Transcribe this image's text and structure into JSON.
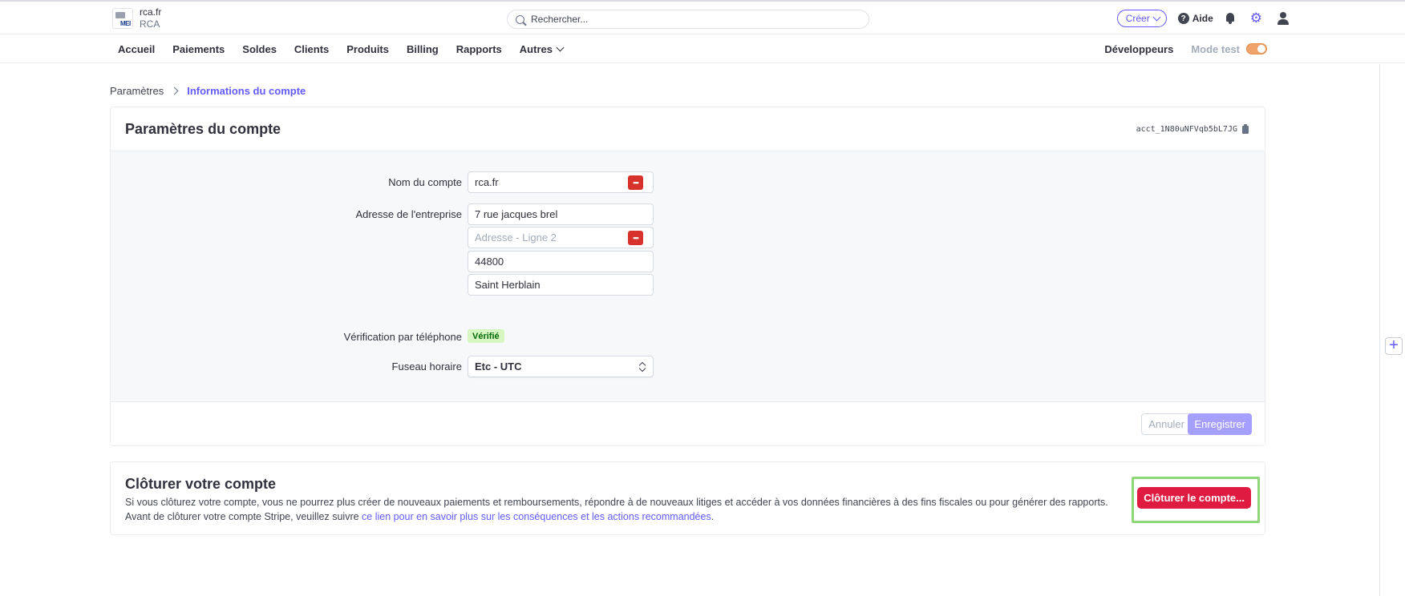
{
  "account": {
    "name": "rca.fr",
    "subname": "RCA",
    "logo_text": "MEI"
  },
  "search": {
    "placeholder": "Rechercher..."
  },
  "topbar": {
    "create_label": "Créer",
    "help_label": "Aide"
  },
  "nav": {
    "items": [
      "Accueil",
      "Paiements",
      "Soldes",
      "Clients",
      "Produits",
      "Billing",
      "Rapports"
    ],
    "more_label": "Autres",
    "developers_label": "Développeurs",
    "test_mode_label": "Mode test"
  },
  "breadcrumb": {
    "parent": "Paramètres",
    "current": "Informations du compte"
  },
  "settings": {
    "title": "Paramètres du compte",
    "account_id": "acct_1N80uNFVqb5bL7JG",
    "fields": {
      "account_name_label": "Nom du compte",
      "account_name_value": "rca.fr",
      "address_label": "Adresse de l'entreprise",
      "address_line1": "7 rue jacques brel",
      "address_line2_placeholder": "Adresse - Ligne 2",
      "postal_code": "44800",
      "city": "Saint Herblain",
      "phone_verification_label": "Vérification par téléphone",
      "phone_verification_status": "Vérifié",
      "timezone_label": "Fuseau horaire",
      "timezone_value": "Etc - UTC"
    },
    "cancel_label": "Annuler",
    "save_label": "Enregistrer",
    "password_badge": "•••"
  },
  "close_account": {
    "title": "Clôturer votre compte",
    "description_1": "Si vous clôturez votre compte, vous ne pourrez plus créer de nouveaux paiements et remboursements, répondre à de nouveaux litiges et accéder à vos données financières à des fins fiscales ou pour générer des rapports. Avant de clôturer votre compte Stripe, veuillez suivre ",
    "link_text": "ce lien pour en savoir plus sur les conséquences et les actions recommandées",
    "description_end": ".",
    "button_label": "Clôturer le compte..."
  },
  "colors": {
    "accent": "#635bff",
    "danger": "#df1b41",
    "highlight": "#8fd57a"
  }
}
